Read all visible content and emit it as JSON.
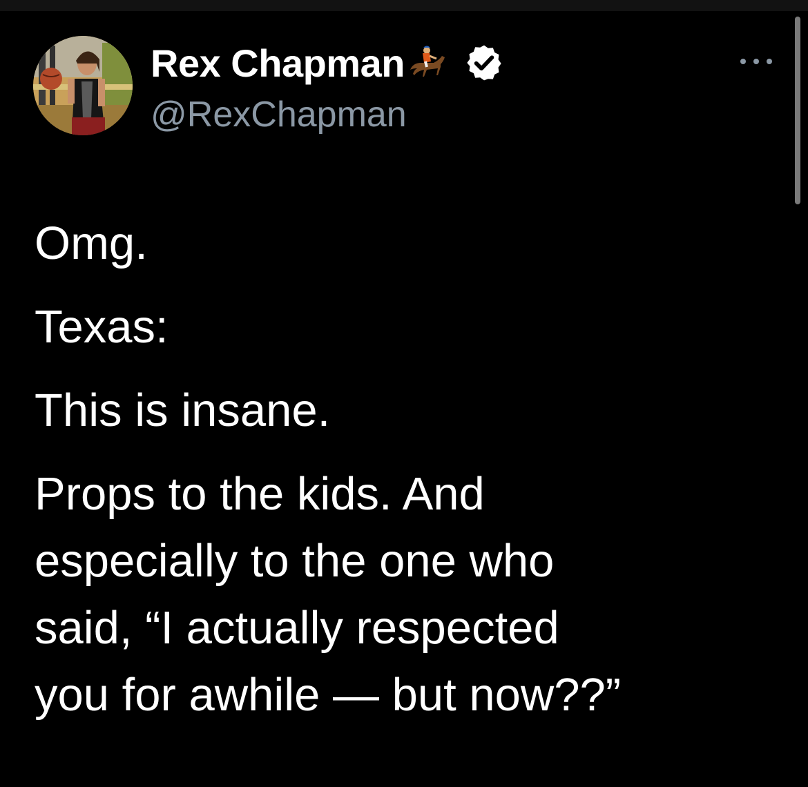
{
  "tweet": {
    "author": {
      "display_name": "Rex Chapman",
      "name_emoji": "horse-racing-jockey",
      "verified": true,
      "handle": "@RexChapman"
    },
    "menu_icon": "more-dots-icon",
    "body": {
      "p1": "Omg.",
      "p2": "Texas:",
      "p3": "This is insane.",
      "p4_lines": [
        "Props to the kids. And",
        "especially to the one who",
        "said, “I actually respected",
        "you for awhile — but now??”"
      ]
    }
  },
  "colors": {
    "background": "#000000",
    "text_primary": "#ffffff",
    "text_secondary": "#8b98a5",
    "verified_badge": "#ffffff"
  }
}
